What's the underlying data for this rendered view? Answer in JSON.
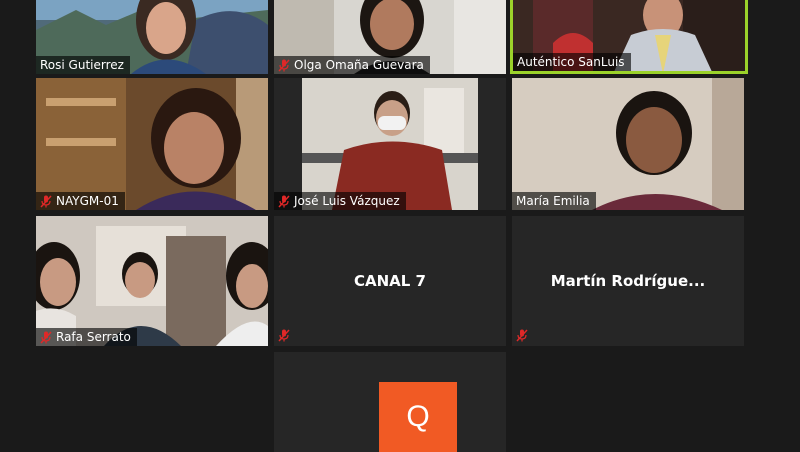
{
  "participants": [
    {
      "name": "Rosi Gutierrez",
      "muted": false
    },
    {
      "name": "Olga Omaña Guevara",
      "muted": true
    },
    {
      "name": "Auténtico SanLuis",
      "muted": false,
      "active_speaker": true
    },
    {
      "name": "NAYGM-01",
      "muted": true
    },
    {
      "name": "José Luis Vázquez",
      "muted": true
    },
    {
      "name": "María Emilia",
      "muted": false
    },
    {
      "name": "Rafa Serrato",
      "muted": true
    },
    {
      "name": "CANAL 7",
      "muted": true,
      "video_off": true
    },
    {
      "name": "Martín  Rodrígue...",
      "muted": true,
      "video_off": true
    },
    {
      "avatar_letter": "Q",
      "avatar_color": "#f15a24",
      "video_off": true
    }
  ],
  "colors": {
    "active_speaker_border": "#9bd22a",
    "muted_icon": "#e02828",
    "tile_bg": "#262626",
    "page_bg": "#1a1a1a"
  }
}
